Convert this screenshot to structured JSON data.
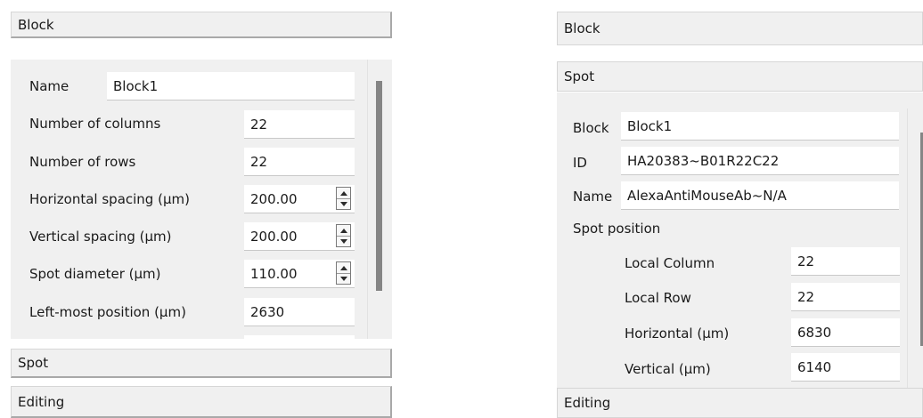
{
  "left": {
    "header_block": "Block",
    "fields": [
      {
        "label": "Name",
        "value": "Block1"
      },
      {
        "label": "Number of columns",
        "value": "22"
      },
      {
        "label": "Number of rows",
        "value": "22"
      },
      {
        "label": "Horizontal spacing (µm)",
        "value": "200.00"
      },
      {
        "label": "Vertical spacing (µm)",
        "value": "200.00"
      },
      {
        "label": "Spot diameter (µm)",
        "value": "110.00"
      },
      {
        "label": "Left-most position (µm)",
        "value": "2630"
      }
    ],
    "header_spot": "Spot",
    "header_editing": "Editing"
  },
  "right": {
    "header_block": "Block",
    "header_spot": "Spot",
    "fields": [
      {
        "label": "Block",
        "value": "Block1"
      },
      {
        "label": "ID",
        "value": "HA20383~B01R22C22"
      },
      {
        "label": "Name",
        "value": "AlexaAntiMouseAb~N/A"
      }
    ],
    "spot_position_label": "Spot position",
    "position_fields": [
      {
        "label": "Local Column",
        "value": "22"
      },
      {
        "label": "Local Row",
        "value": "22"
      },
      {
        "label": "Horizontal (µm)",
        "value": "6830"
      },
      {
        "label": "Vertical (µm)",
        "value": "6140"
      }
    ],
    "header_editing": "Editing"
  }
}
